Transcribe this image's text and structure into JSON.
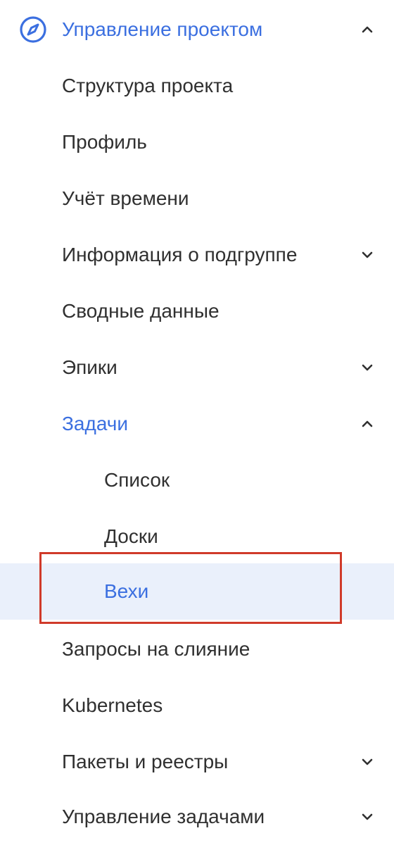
{
  "menu": {
    "header": {
      "label": "Управление проектом",
      "icon": "compass-icon",
      "expanded": true
    },
    "items": [
      {
        "label": "Структура проекта"
      },
      {
        "label": "Профиль"
      },
      {
        "label": "Учёт времени"
      },
      {
        "label": "Информация о подгруппе",
        "has_children": true,
        "expanded": false
      },
      {
        "label": "Сводные данные"
      },
      {
        "label": "Эпики",
        "has_children": true,
        "expanded": false
      },
      {
        "label": "Задачи",
        "has_children": true,
        "expanded": true,
        "active": true
      },
      {
        "label": "Список"
      },
      {
        "label": "Доски"
      },
      {
        "label": "Вехи",
        "selected": true
      },
      {
        "label": "Запросы на слияние"
      },
      {
        "label": "Kubernetes"
      },
      {
        "label": "Пакеты и реестры",
        "has_children": true,
        "expanded": false
      },
      {
        "label": "Управление задачами",
        "has_children": true,
        "expanded": false
      }
    ]
  },
  "colors": {
    "accent": "#3b6fe0",
    "text": "#303030",
    "selected_bg": "#eaf0fb",
    "highlight_border": "#d03a2a"
  }
}
